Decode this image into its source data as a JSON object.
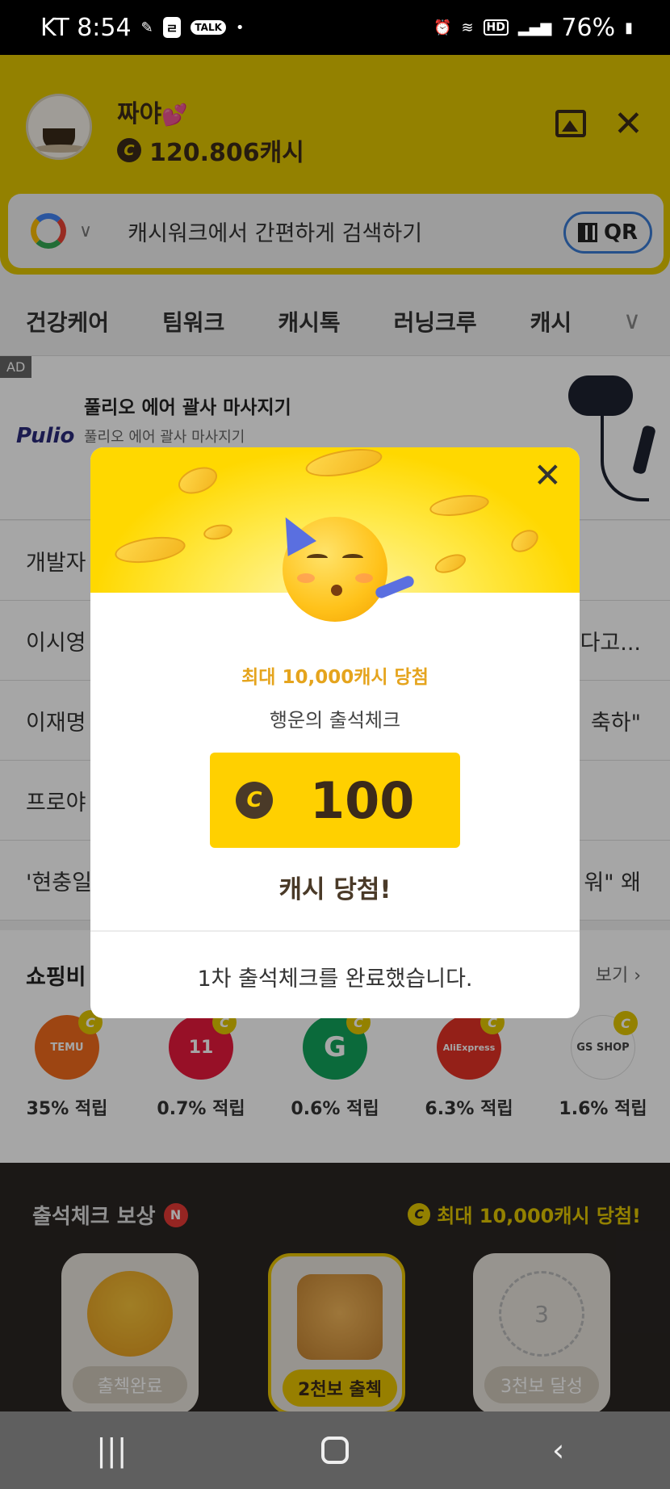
{
  "status_bar": {
    "carrier_time": "KT 8:54",
    "talk": "TALK",
    "battery": "76%",
    "hd": "HD"
  },
  "profile": {
    "name": "짜야",
    "cash": "120.806캐시"
  },
  "search": {
    "placeholder": "캐시워크에서 간편하게 검색하기",
    "qr_label": "QR"
  },
  "tabs": [
    "건강케어",
    "팀워크",
    "캐시톡",
    "러닝크루",
    "캐시"
  ],
  "ad": {
    "badge": "AD",
    "brand": "Pulio",
    "title": "풀리오 에어 괄사 마사지기",
    "subtitle": "풀리오 에어 괄사 마사지기"
  },
  "news": [
    {
      "left": "개발자",
      "right": ""
    },
    {
      "left": "이시영",
      "right": "다고..."
    },
    {
      "left": "이재명",
      "right": "축하\""
    },
    {
      "left": "프로야",
      "right": ""
    },
    {
      "left": "'현충일",
      "right": "워\" 왜"
    }
  ],
  "shopping": {
    "title": "쇼핑비",
    "more": "보기",
    "stores": [
      {
        "name": "TEMU",
        "rate": "35% 적립",
        "color": "#f26b1d"
      },
      {
        "name": "11",
        "rate": "0.7% 적립",
        "color": "#e8193c"
      },
      {
        "name": "G",
        "rate": "0.6% 적립",
        "color": "#11a35b"
      },
      {
        "name": "AliExpress",
        "rate": "6.3% 적립",
        "color": "#e43225"
      },
      {
        "name": "GS SHOP",
        "rate": "1.6% 적립",
        "color": "#ffffff"
      }
    ]
  },
  "attendance": {
    "title": "출석체크 보상",
    "badge": "N",
    "right_text": "최대 10,000캐시 당첨!",
    "cards": [
      {
        "label": "출첵완료"
      },
      {
        "label": "2천보 출첵"
      },
      {
        "label": "3천보 달성",
        "step": "3"
      }
    ]
  },
  "modal": {
    "subtitle": "최대 10,000캐시 당첨",
    "description": "행운의 출석체크",
    "coin_symbol": "C",
    "amount": "100",
    "win_text": "캐시 당첨!",
    "footer": "1차 출석체크를 완료했습니다."
  },
  "colors": {
    "brand_yellow": "#ffd000",
    "header_yellow": "#e2c600",
    "accent_orange": "#e5a41d"
  }
}
